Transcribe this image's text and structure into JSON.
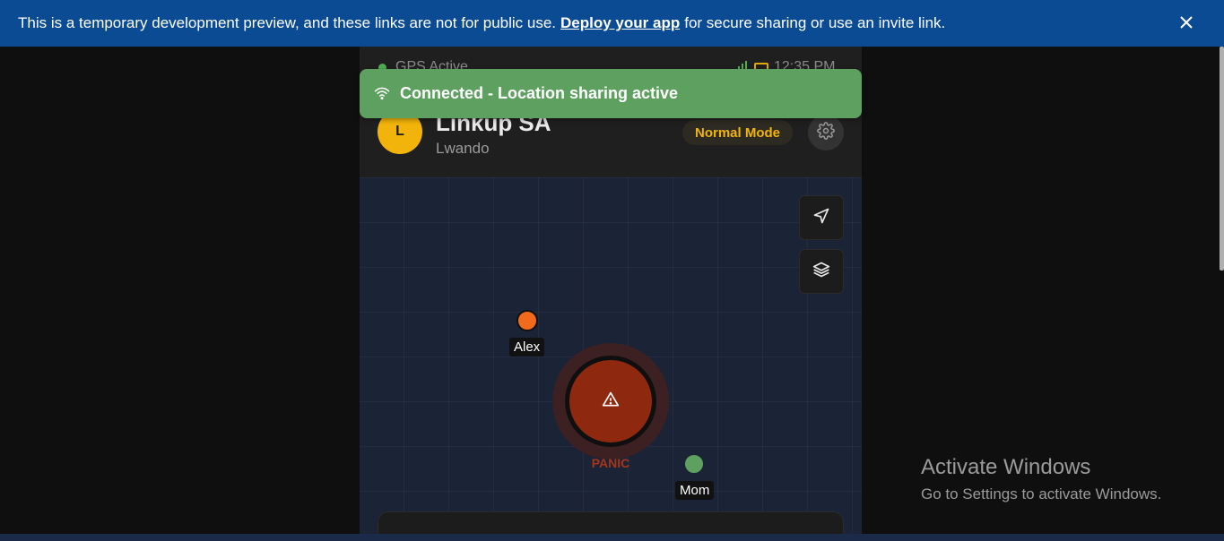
{
  "banner": {
    "text_before": "This is a temporary development preview, and these links are not for public use.",
    "link_label": "Deploy your app",
    "text_after": "for secure sharing or use an invite link.",
    "close_icon": "close-icon"
  },
  "statusbar": {
    "gps_label": "GPS Active",
    "time": "12:35 PM"
  },
  "header": {
    "avatar_initial": "L",
    "app_title": "Linkup SA",
    "user_name": "Lwando",
    "mode_label": "Normal Mode",
    "settings_icon": "gear-icon"
  },
  "toast": {
    "message": "Connected - Location sharing active",
    "icon": "wifi-icon"
  },
  "map": {
    "controls": [
      {
        "icon": "navigation-icon"
      },
      {
        "icon": "layers-icon"
      }
    ],
    "contacts": [
      {
        "name": "Alex",
        "color": "#f26a1b"
      },
      {
        "name": "Mom",
        "color": "#5ea060"
      }
    ],
    "panic_label": "PANIC",
    "panic_icon": "warning-icon"
  },
  "os_watermark": {
    "title": "Activate Windows",
    "subtitle": "Go to Settings to activate Windows."
  },
  "colors": {
    "banner": "#0b4b93",
    "accent_yellow": "#f2b40a",
    "toast_green": "#5ea060",
    "panic_red": "#8e2910"
  }
}
